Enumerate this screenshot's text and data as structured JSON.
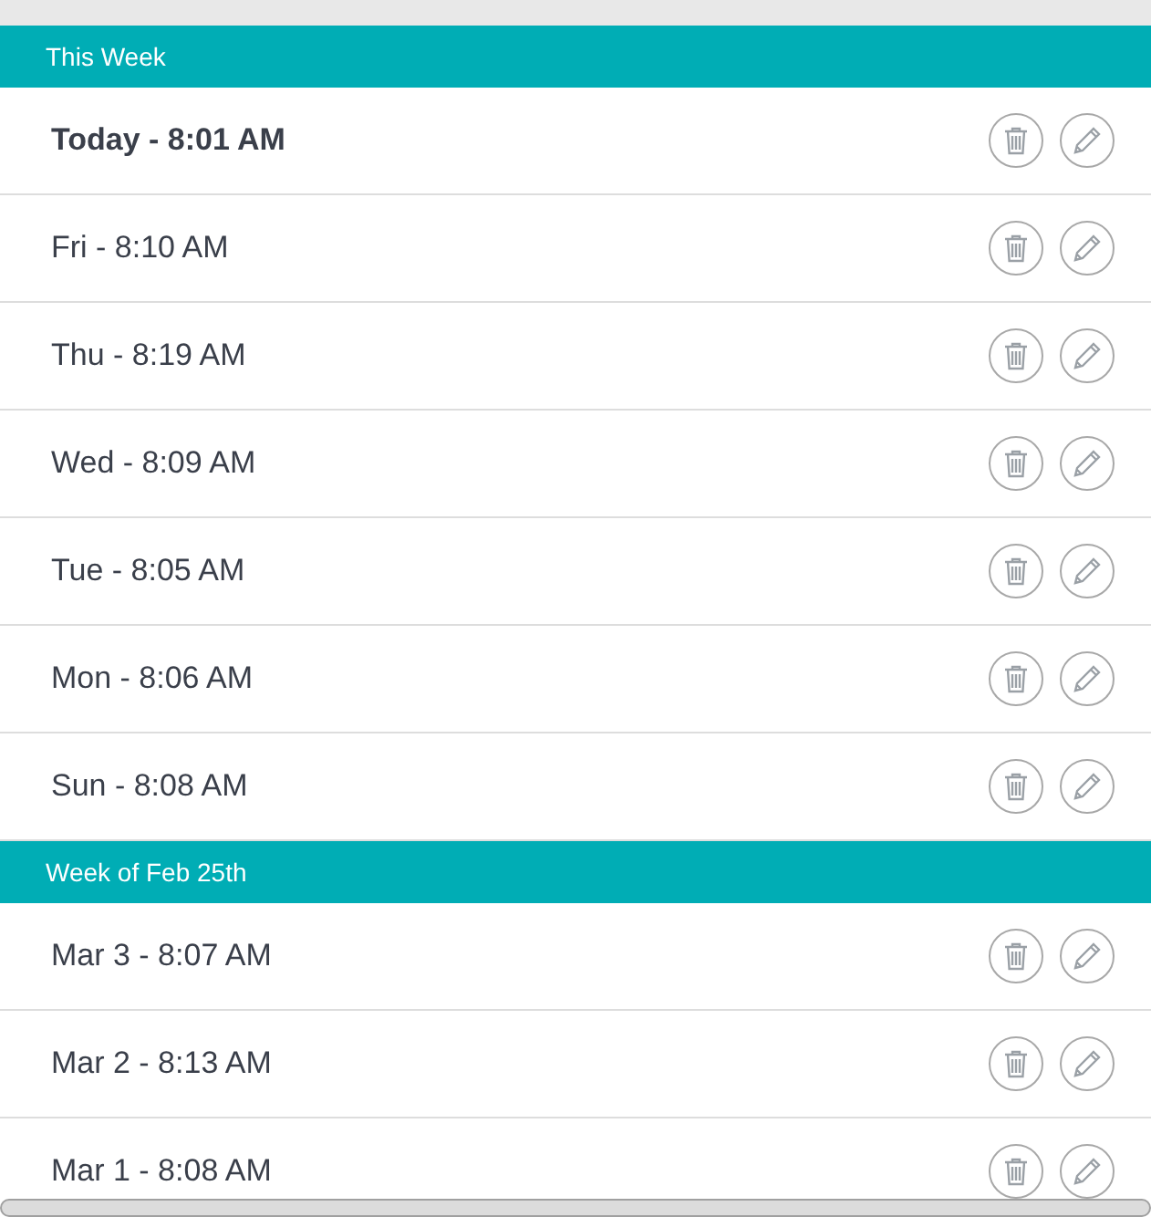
{
  "sections": [
    {
      "title": "This Week",
      "entries": [
        {
          "label": "Today - 8:01 AM",
          "current": true
        },
        {
          "label": "Fri - 8:10 AM",
          "current": false
        },
        {
          "label": "Thu - 8:19 AM",
          "current": false
        },
        {
          "label": "Wed - 8:09 AM",
          "current": false
        },
        {
          "label": "Tue - 8:05 AM",
          "current": false
        },
        {
          "label": "Mon - 8:06 AM",
          "current": false
        },
        {
          "label": "Sun - 8:08 AM",
          "current": false
        }
      ]
    },
    {
      "title": "Week of Feb 25th",
      "entries": [
        {
          "label": "Mar 3 - 8:07 AM",
          "current": false
        },
        {
          "label": "Mar 2 - 8:13 AM",
          "current": false
        },
        {
          "label": "Mar 1 - 8:08 AM",
          "current": false
        }
      ]
    }
  ]
}
